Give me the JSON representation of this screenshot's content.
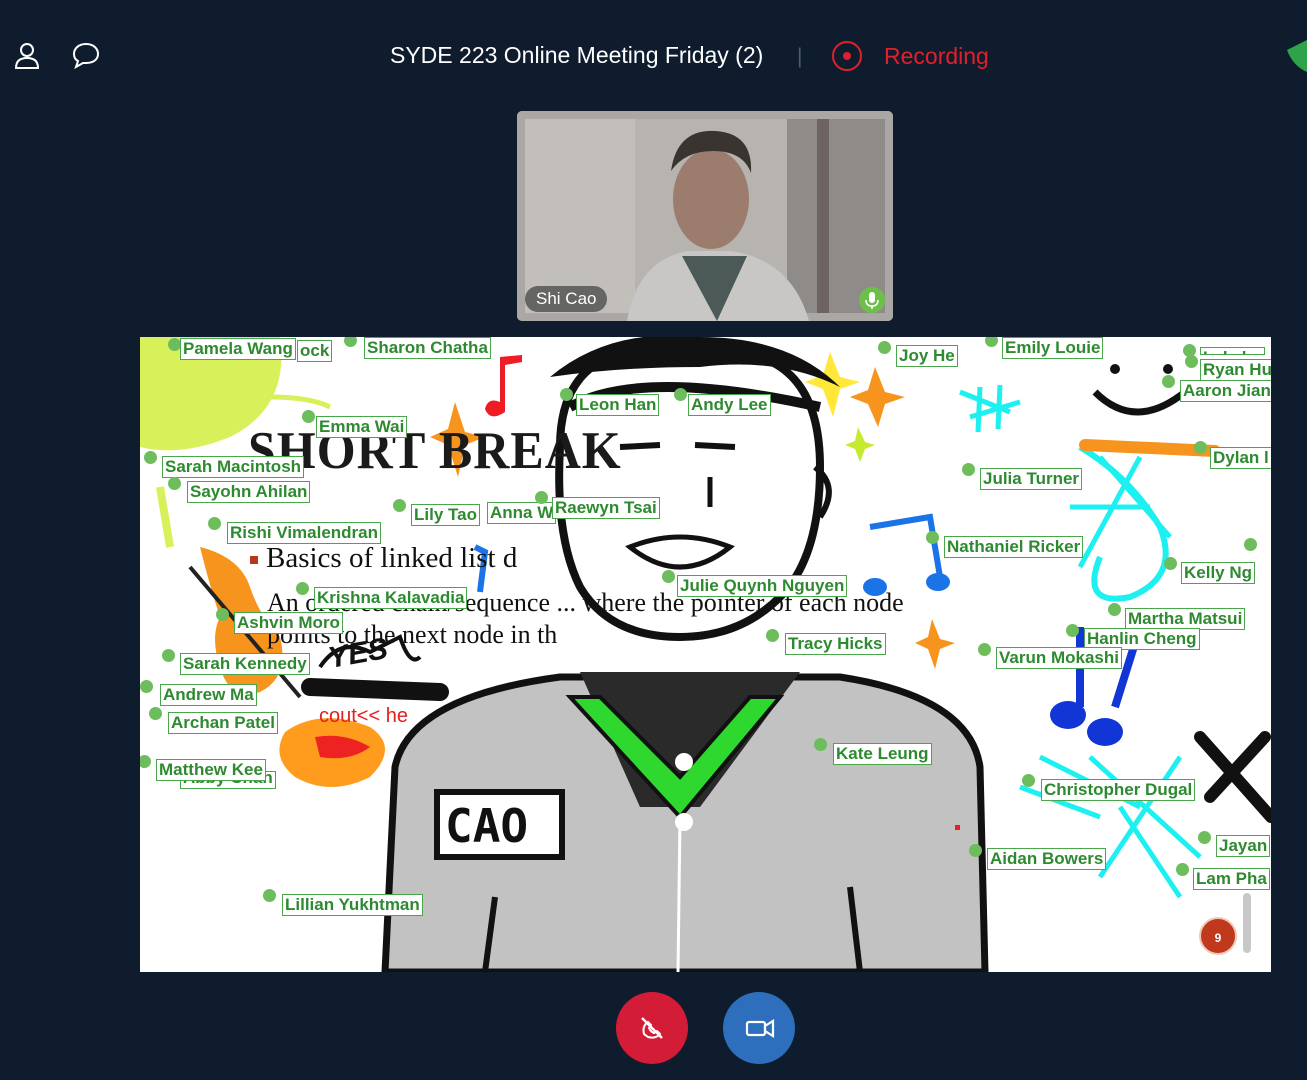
{
  "header": {
    "meeting_title": "SYDE 223 Online Meeting Friday (2)",
    "separator": "|",
    "recording_label": "Recording",
    "icons": [
      "person-icon",
      "chat-icon",
      "record-icon"
    ]
  },
  "webcam": {
    "presenter_name": "Shi Cao"
  },
  "slide": {
    "title": "SHORT BREAK",
    "bullet": "Basics of linked list d",
    "line1": "An ordered chain/sequence ... where the pointer of each node",
    "line2": "points to the next node in th",
    "code": "cout<< he",
    "drawn_name_tag": "CAO",
    "drawn_yes": "YES"
  },
  "participants": [
    "Pamela Wang",
    "ock",
    "Sharon Chatha",
    "Joy He",
    "Emily Louie",
    "Lakshy",
    "Ryan Hu",
    "Aaron Jian",
    "Leon Han",
    "Andy Lee",
    "Emma Wai",
    "Sarah Macintosh",
    "Dylan l",
    "Sayohn Ahilan",
    "Julia Turner",
    "Lily Tao",
    "Anna W",
    "Raewyn Tsai",
    "Rishi Vimalendran",
    "Nathaniel Ricker",
    "Kelly Ng",
    "Krishna Kalavadia",
    "Julie Quynh Nguyen",
    "Ashvin Moro",
    "Martha Matsui",
    "Hanlin Cheng",
    "Tracy Hicks",
    "Sarah Kennedy",
    "Varun Mokashi",
    "Andrew Ma",
    "Archan Patel",
    "Kate Leung",
    "Matthew Kee",
    "Abby Chan",
    "Christopher Dugal",
    "Jayan",
    "Aidan Bowers",
    "Lam Pha",
    "Lillian Yukhtman"
  ],
  "slide_page_number": "9",
  "controls": {
    "hangup": "hang-up-button",
    "video": "video-toggle-button"
  },
  "colors": {
    "background": "#0f1c2e",
    "recording": "#e0202d",
    "hangup": "#d31c35",
    "video": "#2d6fbc",
    "cursor_tag": "#2e8a30"
  }
}
